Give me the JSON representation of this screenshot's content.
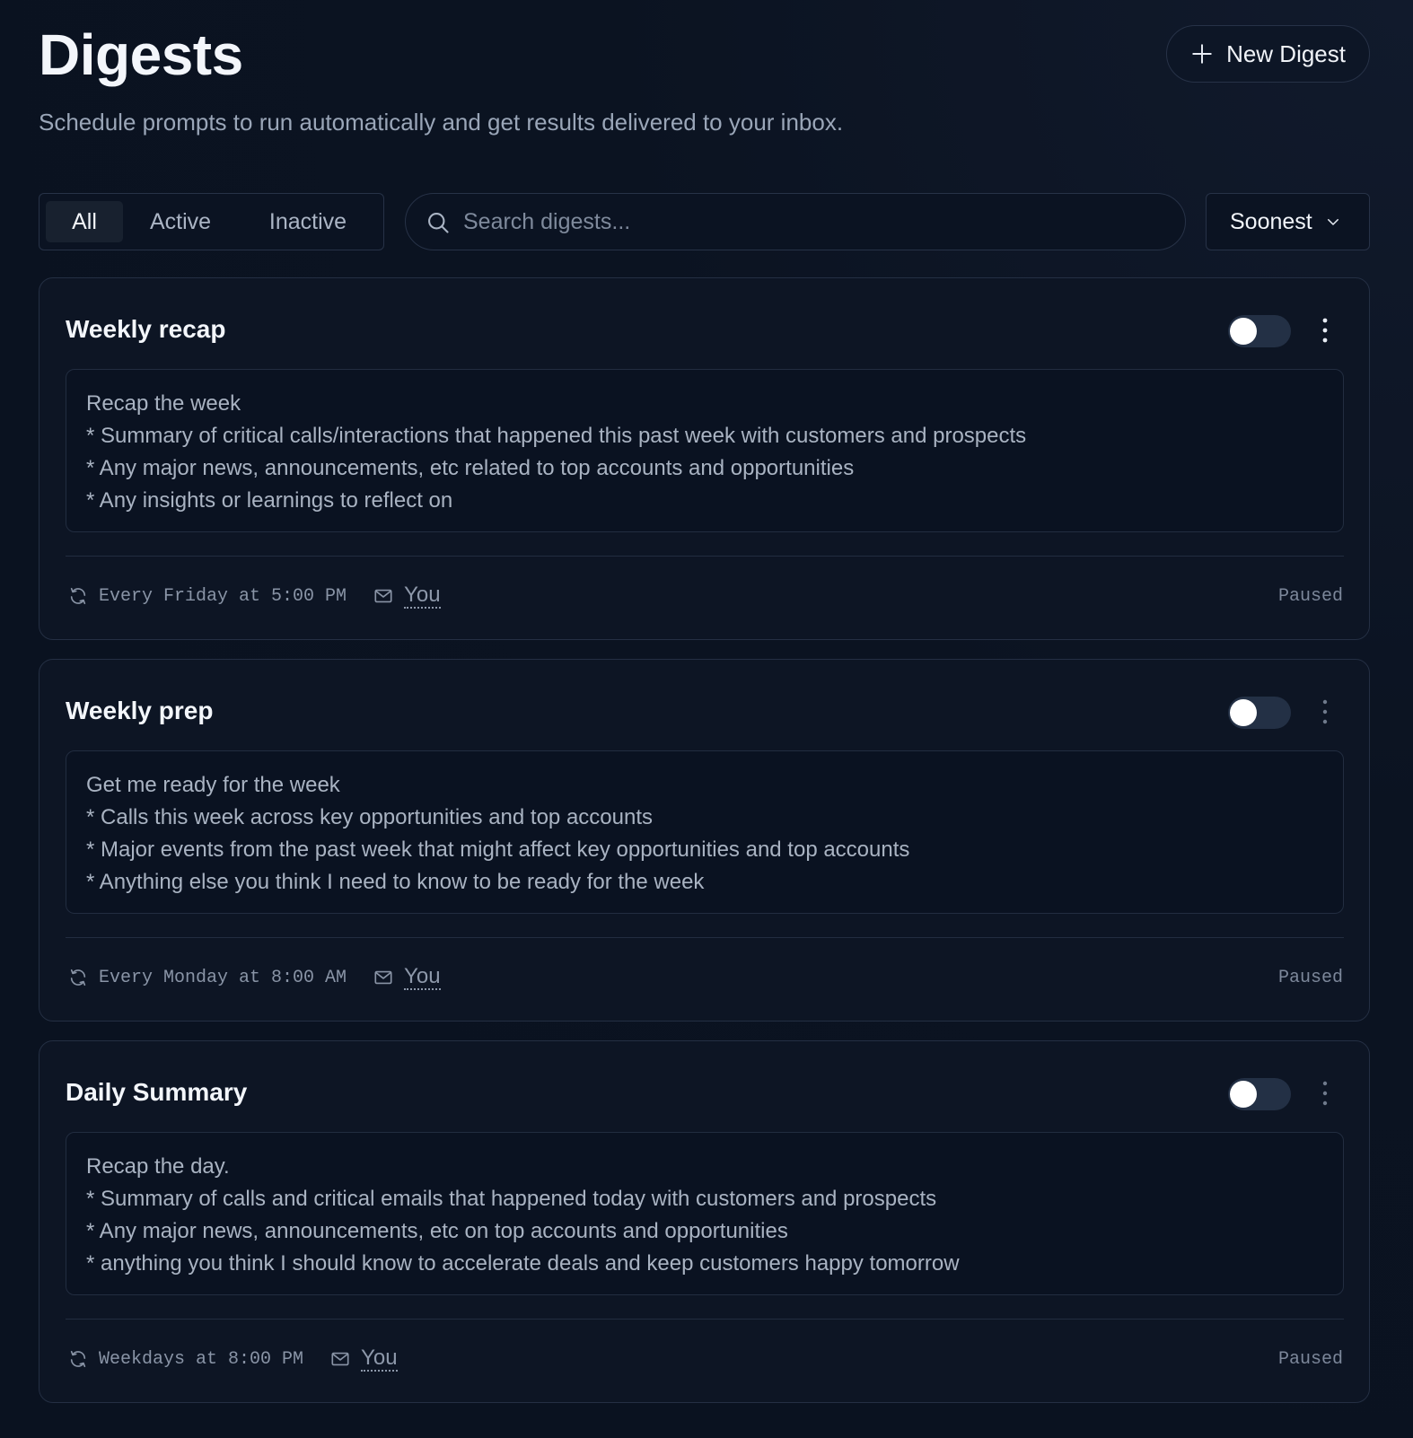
{
  "header": {
    "title": "Digests",
    "subtitle": "Schedule prompts to run automatically and get results delivered to your inbox.",
    "new_button_label": "New Digest"
  },
  "filters": {
    "tabs": [
      {
        "label": "All",
        "active": true
      },
      {
        "label": "Active",
        "active": false
      },
      {
        "label": "Inactive",
        "active": false
      }
    ],
    "search_placeholder": "Search digests...",
    "search_value": "",
    "sort_label": "Soonest"
  },
  "icons": {
    "new": "plus-icon",
    "search": "search-icon",
    "sort": "chevron-down-icon",
    "menu": "more-vertical-icon",
    "schedule": "refresh-icon",
    "recipient": "mail-icon"
  },
  "colors": {
    "background": "#0b1321",
    "card": "#0d1524",
    "border": "#242f43",
    "toggle_track": "#233045",
    "toggle_knob": "#ffffff"
  },
  "digests": [
    {
      "title": "Weekly recap",
      "enabled": false,
      "prompt": [
        "Recap the week",
        "* Summary of critical calls/interactions that happened this past week with customers and prospects",
        "* Any major news, announcements, etc related to top accounts and opportunities",
        "* Any insights or learnings to reflect on"
      ],
      "schedule": "Every Friday at 5:00 PM",
      "recipient": "You",
      "status": "Paused"
    },
    {
      "title": "Weekly prep",
      "enabled": false,
      "prompt": [
        "Get me ready for the week",
        "* Calls this week across key opportunities and top accounts",
        "* Major events from the past week that might affect key opportunities and top accounts",
        "* Anything else you think I need to know to be ready for the week"
      ],
      "schedule": "Every Monday at 8:00 AM",
      "recipient": "You",
      "status": "Paused"
    },
    {
      "title": "Daily Summary",
      "enabled": false,
      "prompt": [
        "Recap the day.",
        "* Summary of calls and critical emails that happened today with customers and prospects",
        "* Any major news, announcements, etc on top accounts and opportunities",
        "* anything you think I should know to accelerate deals and keep customers happy tomorrow"
      ],
      "schedule": "Weekdays at 8:00 PM",
      "recipient": "You",
      "status": "Paused"
    }
  ]
}
